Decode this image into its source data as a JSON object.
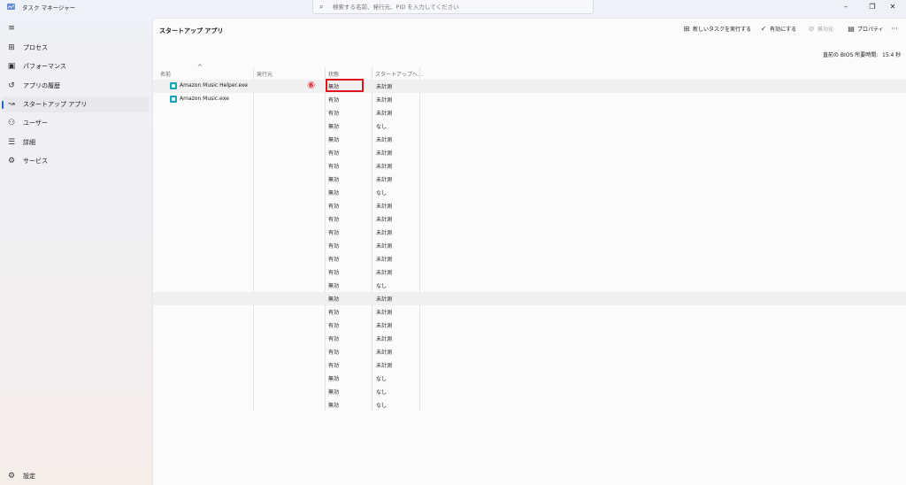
{
  "titlebar": {
    "title": "タスク マネージャー",
    "search_placeholder": "検索する名前、発行元、PID を入力してください",
    "minimize": "–",
    "restore": "❐",
    "close": "✕"
  },
  "sidebar": {
    "hamburger": "≡",
    "items": [
      {
        "label": "プロセス",
        "icon": "⊞"
      },
      {
        "label": "パフォーマンス",
        "icon": "▣"
      },
      {
        "label": "アプリの履歴",
        "icon": "↺"
      },
      {
        "label": "スタートアップ アプリ",
        "icon": "↝"
      },
      {
        "label": "ユーザー",
        "icon": "⚇"
      },
      {
        "label": "詳細",
        "icon": "☰"
      },
      {
        "label": "サービス",
        "icon": "⚙"
      }
    ],
    "settings": {
      "label": "設定",
      "icon": "⚙"
    }
  },
  "toolbar": {
    "page_title": "スタートアップ アプリ",
    "new_task": "新しいタスクを実行する",
    "enable": "有効にする",
    "disable": "無効化",
    "properties": "プロパティ",
    "more": "···"
  },
  "bios": {
    "label": "直前の BIOS 所要時間:",
    "value": "15.4 秒"
  },
  "table": {
    "sort_indicator": "^",
    "headers": {
      "name": "名前",
      "publisher": "発行元",
      "status": "状態",
      "impact": "スタートアップへ..."
    },
    "rows": [
      {
        "name": "Amazon Music Helper.exe",
        "status": "無効",
        "impact": "未計測"
      },
      {
        "name": "Amazon Music.exe",
        "status": "有効",
        "impact": "未計測"
      },
      {
        "name": "",
        "status": "有効",
        "impact": "未計測"
      },
      {
        "name": "",
        "status": "無効",
        "impact": "なし"
      },
      {
        "name": "",
        "status": "無効",
        "impact": "未計測"
      },
      {
        "name": "",
        "status": "有効",
        "impact": "未計測"
      },
      {
        "name": "",
        "status": "有効",
        "impact": "未計測"
      },
      {
        "name": "",
        "status": "無効",
        "impact": "未計測"
      },
      {
        "name": "",
        "status": "無効",
        "impact": "なし"
      },
      {
        "name": "",
        "status": "有効",
        "impact": "未計測"
      },
      {
        "name": "",
        "status": "有効",
        "impact": "未計測"
      },
      {
        "name": "",
        "status": "有効",
        "impact": "未計測"
      },
      {
        "name": "",
        "status": "有効",
        "impact": "未計測"
      },
      {
        "name": "",
        "status": "有効",
        "impact": "未計測"
      },
      {
        "name": "",
        "status": "有効",
        "impact": "未計測"
      },
      {
        "name": "",
        "status": "無効",
        "impact": "なし"
      },
      {
        "name": "",
        "status": "無効",
        "impact": "未計測"
      },
      {
        "name": "",
        "status": "有効",
        "impact": "未計測"
      },
      {
        "name": "",
        "status": "有効",
        "impact": "未計測"
      },
      {
        "name": "",
        "status": "有効",
        "impact": "未計測"
      },
      {
        "name": "",
        "status": "有効",
        "impact": "未計測"
      },
      {
        "name": "",
        "status": "有効",
        "impact": "未計測"
      },
      {
        "name": "",
        "status": "無効",
        "impact": "なし"
      },
      {
        "name": "",
        "status": "無効",
        "impact": "なし"
      },
      {
        "name": "",
        "status": "無効",
        "impact": "なし"
      }
    ]
  },
  "annotation": {
    "marker": "⑥",
    "color": "#e0141c"
  },
  "colors": {
    "accent": "#2a64c8",
    "exe_icon": "#1aa6b7"
  }
}
